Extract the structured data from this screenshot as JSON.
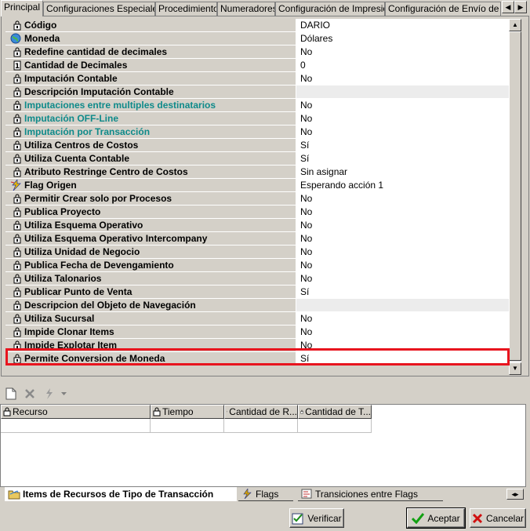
{
  "tabs": [
    {
      "label": "Principal",
      "active": true
    },
    {
      "label": "Configuraciones Especiales"
    },
    {
      "label": "Procedimiento"
    },
    {
      "label": "Numeradores"
    },
    {
      "label": "Configuración de Impresión"
    },
    {
      "label": "Configuración de Envío de M"
    }
  ],
  "properties": [
    {
      "name": "Código",
      "value": "DARIO",
      "icon": "lock-icon"
    },
    {
      "name": "Moneda",
      "value": "Dólares",
      "icon": "globe-icon"
    },
    {
      "name": "Redefine cantidad de decimales",
      "value": "No",
      "icon": "lock-icon"
    },
    {
      "name": "Cantidad de Decimales",
      "value": "0",
      "icon": "numeric-icon"
    },
    {
      "name": "Imputación Contable",
      "value": "No",
      "icon": "lock-icon"
    },
    {
      "name": "Descripción Imputación Contable",
      "value": "",
      "icon": "lock-icon"
    },
    {
      "name": "Imputaciones entre multiples destinatarios",
      "value": "No",
      "icon": "lock-icon",
      "teal": true
    },
    {
      "name": "Imputación OFF-Line",
      "value": "No",
      "icon": "lock-icon",
      "teal": true
    },
    {
      "name": "Imputación por Transacción",
      "value": "No",
      "icon": "lock-icon",
      "teal": true
    },
    {
      "name": "Utiliza Centros de Costos",
      "value": "Sí",
      "icon": "lock-icon"
    },
    {
      "name": "Utiliza Cuenta  Contable",
      "value": "Sí",
      "icon": "lock-icon"
    },
    {
      "name": "Atributo Restringe Centro de Costos",
      "value": "Sin asignar",
      "icon": "lock-icon"
    },
    {
      "name": "Flag Origen",
      "value": "Esperando acción 1",
      "icon": "flag-icon"
    },
    {
      "name": "Permitir Crear solo por Procesos",
      "value": "No",
      "icon": "lock-icon"
    },
    {
      "name": "Publica Proyecto",
      "value": "No",
      "icon": "lock-icon"
    },
    {
      "name": "Utiliza Esquema Operativo",
      "value": "No",
      "icon": "lock-icon"
    },
    {
      "name": "Utiliza Esquema Operativo Intercompany",
      "value": "No",
      "icon": "lock-icon"
    },
    {
      "name": "Utiliza Unidad de Negocio",
      "value": "No",
      "icon": "lock-icon"
    },
    {
      "name": "Publica Fecha de Devengamiento",
      "value": "No",
      "icon": "lock-icon"
    },
    {
      "name": "Utiliza Talonarios",
      "value": "No",
      "icon": "lock-icon"
    },
    {
      "name": "Publicar Punto de Venta",
      "value": "Sí",
      "icon": "lock-icon"
    },
    {
      "name": "Descripcion del Objeto de  Navegación",
      "value": "",
      "icon": "lock-icon"
    },
    {
      "name": "Utiliza Sucursal",
      "value": "No",
      "icon": "lock-icon"
    },
    {
      "name": "Impide Clonar Items",
      "value": "No",
      "icon": "lock-icon"
    },
    {
      "name": "Impide Explotar Item",
      "value": "No",
      "icon": "lock-icon"
    },
    {
      "name": "Permite Conversion de Moneda",
      "value": "Sí",
      "icon": "lock-icon",
      "highlighted": true
    }
  ],
  "toolbar": {
    "icons": [
      "new-document-icon",
      "delete-icon",
      "flag-action-icon",
      "dropdown-arrow-icon"
    ]
  },
  "table": {
    "columns": [
      "Recurso",
      "Tiempo",
      "Cantidad de R...",
      "Cantidad de T..."
    ]
  },
  "bottom_tabs": [
    {
      "label": "Items de Recursos de Tipo de Transacción",
      "active": true
    },
    {
      "label": "Flags"
    },
    {
      "label": "Transiciones entre Flags"
    }
  ],
  "buttons": {
    "verify": "Verificar",
    "accept": "Aceptar",
    "cancel": "Cancelar"
  },
  "colors": {
    "highlight": "#e8141e",
    "teal_text": "#0e8a8a"
  }
}
